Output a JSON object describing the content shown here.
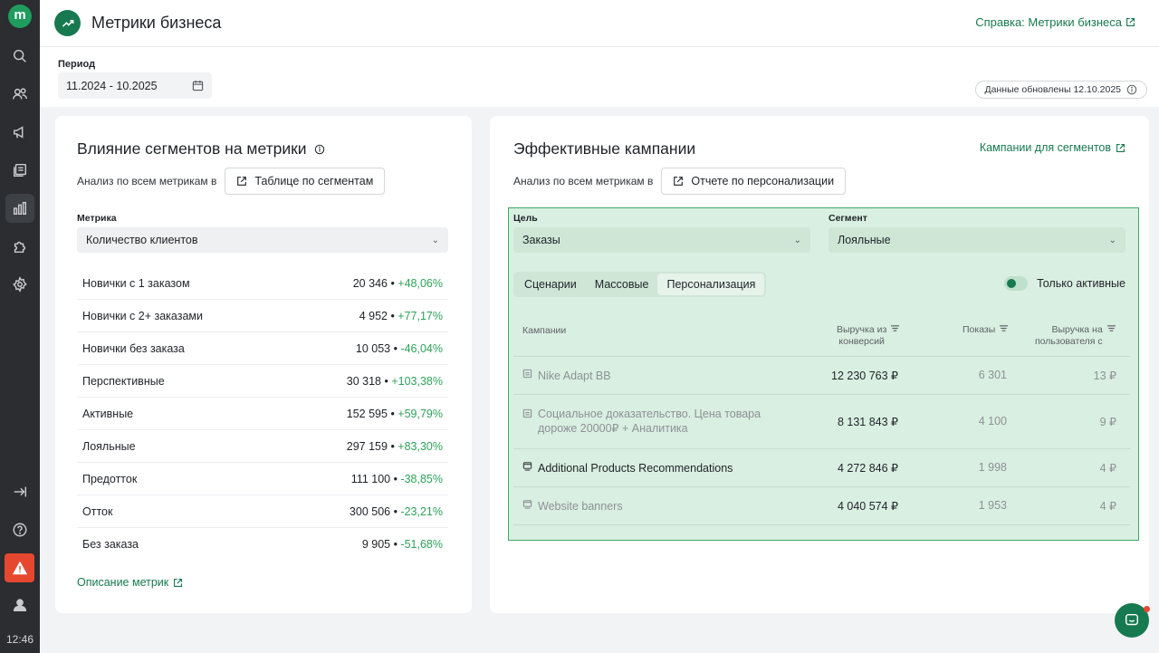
{
  "sidebar": {
    "logo": "m",
    "time": "12:46"
  },
  "header": {
    "title": "Метрики бизнеса",
    "help_link": "Справка: Метрики бизнеса"
  },
  "filters": {
    "period_label": "Период",
    "period_value": "11.2024 - 10.2025",
    "updated": "Данные обновлены 12.10.2025"
  },
  "segments_card": {
    "title": "Влияние сегментов на метрики",
    "analysis_text": "Анализ по всем метрикам в",
    "analysis_button": "Таблице по сегментам",
    "metric_label": "Метрика",
    "metric_value": "Количество клиентов",
    "rows": [
      {
        "name": "Новички с 1 заказом",
        "value": "20 346",
        "pct": "+48,06%"
      },
      {
        "name": "Новички с 2+ заказами",
        "value": "4 952",
        "pct": "+77,17%"
      },
      {
        "name": "Новички без заказа",
        "value": "10 053",
        "pct": "-46,04%"
      },
      {
        "name": "Перспективные",
        "value": "30 318",
        "pct": "+103,38%"
      },
      {
        "name": "Активные",
        "value": "152 595",
        "pct": "+59,79%"
      },
      {
        "name": "Лояльные",
        "value": "297 159",
        "pct": "+83,30%"
      },
      {
        "name": "Предотток",
        "value": "111 100",
        "pct": "-38,85%"
      },
      {
        "name": "Отток",
        "value": "300 506",
        "pct": "-23,21%"
      },
      {
        "name": "Без заказа",
        "value": "9 905",
        "pct": "-51,68%"
      }
    ],
    "description_link": "Описание метрик"
  },
  "campaigns_card": {
    "title": "Эффективные кампании",
    "segments_link": "Кампании для сегментов",
    "analysis_text": "Анализ по всем метрикам в",
    "analysis_button": "Отчете по персонализации",
    "goal_label": "Цель",
    "goal_value": "Заказы",
    "segment_label": "Сегмент",
    "segment_value": "Лояльные",
    "tabs": [
      "Сценарии",
      "Массовые",
      "Персонализация"
    ],
    "active_only": "Только активные",
    "columns": {
      "campaigns": "Кампании",
      "revenue_line1": "Выручка из",
      "revenue_line2": "конверсий",
      "shows": "Показы",
      "rpu_line1": "Выручка на",
      "rpu_line2": "пользователя с"
    },
    "rows": [
      {
        "name": "Nike Adapt BB",
        "revenue": "12 230 763 ₽",
        "shows": "6 301",
        "rpu": "13 ₽"
      },
      {
        "name": "Социальное доказательство. Цена товара дороже 20000₽ + Аналитика",
        "revenue": "8 131 843 ₽",
        "shows": "4 100",
        "rpu": "9 ₽"
      },
      {
        "name": "Additional Products Recommendations",
        "revenue": "4 272 846 ₽",
        "shows": "1 998",
        "rpu": "4 ₽"
      },
      {
        "name": "Website banners",
        "revenue": "4 040 574 ₽",
        "shows": "1 953",
        "rpu": "4 ₽"
      }
    ]
  }
}
